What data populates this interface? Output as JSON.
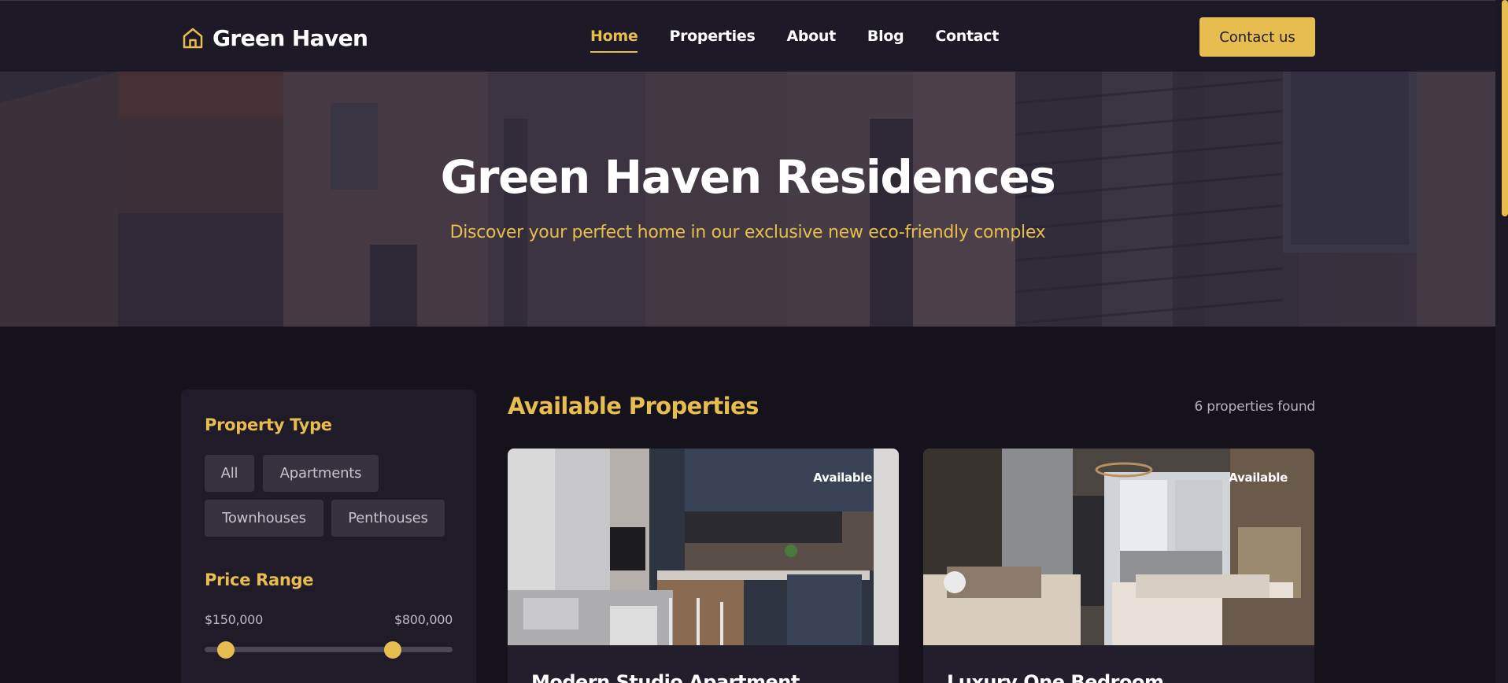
{
  "header": {
    "logo_icon": "home-outline-icon",
    "logo_text": "Green Haven",
    "nav": [
      {
        "label": "Home",
        "active": true
      },
      {
        "label": "Properties",
        "active": false
      },
      {
        "label": "About",
        "active": false
      },
      {
        "label": "Blog",
        "active": false
      },
      {
        "label": "Contact",
        "active": false
      }
    ],
    "cta_label": "Contact us"
  },
  "hero": {
    "title": "Green Haven Residences",
    "subtitle": "Discover your perfect home in our exclusive new eco-friendly complex"
  },
  "filters": {
    "property_type_heading": "Property Type",
    "types": [
      "All",
      "Apartments",
      "Townhouses",
      "Penthouses"
    ],
    "price_heading": "Price Range",
    "price_min_label": "$150,000",
    "price_max_label": "$800,000",
    "slider_low_fraction": 0.087,
    "slider_high_fraction": 0.758
  },
  "properties": {
    "heading": "Available Properties",
    "count_text": "6 properties found",
    "cards": [
      {
        "badge": "Available",
        "title": "Modern Studio Apartment",
        "image": "kitchen-interior-photo"
      },
      {
        "badge": "Available",
        "title": "Luxury One Bedroom",
        "image": "bedroom-interior-photo"
      }
    ]
  },
  "colors": {
    "accent": "#e8bd4f",
    "header_bg": "#1d1926",
    "page_bg": "#15121c",
    "panel_bg": "#1f1b29",
    "chip_bg": "#36323e"
  }
}
